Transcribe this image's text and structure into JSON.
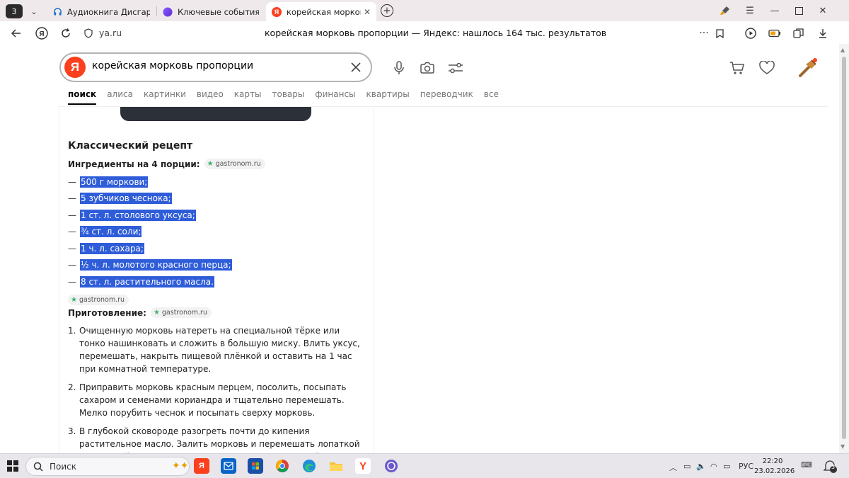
{
  "browser": {
    "tab_count": "3",
    "tabs": [
      {
        "label": "Аудиокнига Дисгардиум",
        "active": false
      },
      {
        "label": "Ключевые события из уч",
        "active": false
      },
      {
        "label": "корейская морковь пр",
        "active": true
      }
    ],
    "domain": "ya.ru",
    "page_title": "корейская морковь пропорции — Яндекс: нашлось 164 тыс. результатов"
  },
  "search": {
    "logo": "Я",
    "query": "корейская морковь пропорции"
  },
  "nav": {
    "items": [
      "поиск",
      "алиса",
      "картинки",
      "видео",
      "карты",
      "товары",
      "финансы",
      "квартиры",
      "переводчик",
      "все"
    ]
  },
  "recipe": {
    "title": "Классический рецепт",
    "ingredients_heading": "Ингредиенты на 4 порции",
    "colon": ":",
    "source": "gastronom.ru",
    "dash": "—",
    "ingredients": [
      "500 г моркови;",
      "5 зубчиков чеснока;",
      "1 ст. л. столового уксуса;",
      "¾ ст. л. соли;",
      "1 ч. л. сахара;",
      "½ ч. л. молотого красного перца;",
      "8 ст. л. растительного масла."
    ],
    "prep_heading": "Приготовление",
    "steps": [
      {
        "num": "1.",
        "text": "Очищенную морковь натереть на специальной тёрке или тонко нашинковать и сложить в большую миску. Влить уксус, перемешать, накрыть пищевой плёнкой и оставить на 1 час при комнатной температуре."
      },
      {
        "num": "2.",
        "text": "Приправить морковь красным перцем, посолить, посыпать сахаром и семенами кориандра и тщательно перемешать. Мелко порубить чеснок и посыпать сверху морковь."
      },
      {
        "num": "3.",
        "text": "В глубокой сковороде разогреть почти до кипения растительное масло. Залить морковь и перемешать лопаткой или вилкой. Немного остудить, переложить в контейнер с герметичной крышкой и убрать"
      }
    ]
  },
  "taskbar": {
    "search_label": "Поиск",
    "lang": "РУС",
    "time": "22:20",
    "date": "23.02.2026",
    "notif_count": "3"
  },
  "colors": {
    "yandex_red": "#fc3f1d",
    "selection": "#2f5dd9"
  }
}
